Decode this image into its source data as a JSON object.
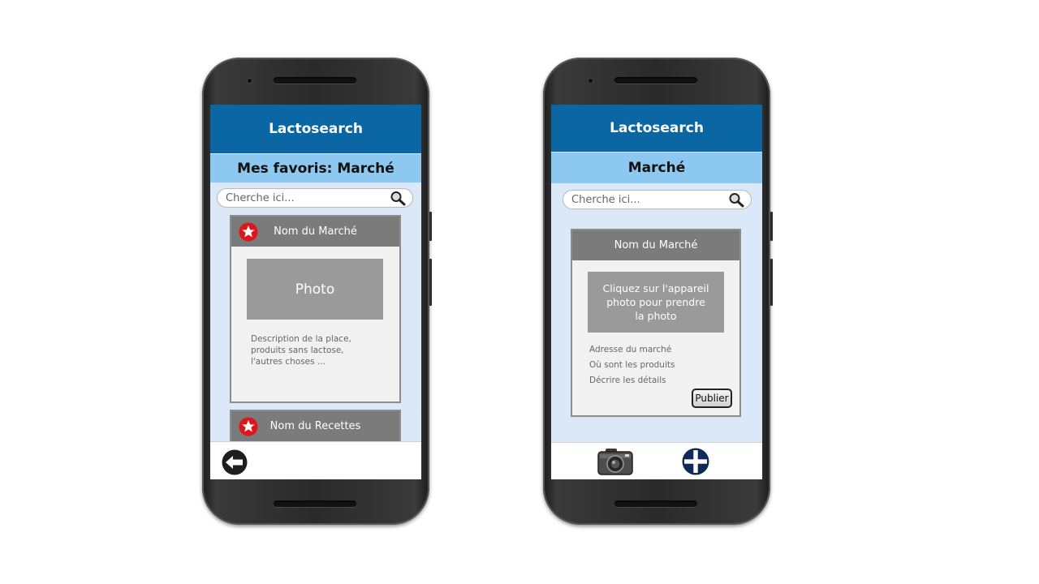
{
  "colors": {
    "appbar": "#0b67a4",
    "subbar": "#8cc8ef",
    "screen_bg": "#dbe8f8",
    "card_header": "#7b7b7b",
    "photo_placeholder": "#9a9a9a",
    "favorite_star": "#e0141b",
    "add_button": "#0f2a57"
  },
  "left_screen": {
    "app_title": "Lactosearch",
    "page_title": "Mes favoris: Marché",
    "search": {
      "placeholder": "Cherche ici...",
      "icon": "search-icon"
    },
    "cards": [
      {
        "title": "Nom du Marché",
        "icon": "favorite-star-icon",
        "photo_label": "Photo",
        "description": [
          "Description de la place,",
          "produits sans lactose,",
          "l'autres choses ..."
        ]
      },
      {
        "title": "Nom du Recettes",
        "icon": "favorite-star-icon"
      }
    ],
    "bottom_bar": {
      "back_icon": "back-arrow-icon"
    }
  },
  "right_screen": {
    "app_title": "Lactosearch",
    "page_title": "Marché",
    "search": {
      "placeholder": "Cherche ici...",
      "icon": "search-icon"
    },
    "card": {
      "title": "Nom du Marché",
      "photo_instruction": [
        "Cliquez sur l'appareil",
        "photo pour prendre",
        "la photo"
      ],
      "fields": [
        "Adresse du marché",
        "Où sont les produits",
        "Décrire les détails"
      ],
      "publish_label": "Publier"
    },
    "bottom_bar": {
      "camera_icon": "camera-icon",
      "add_icon": "add-plus-icon"
    }
  }
}
